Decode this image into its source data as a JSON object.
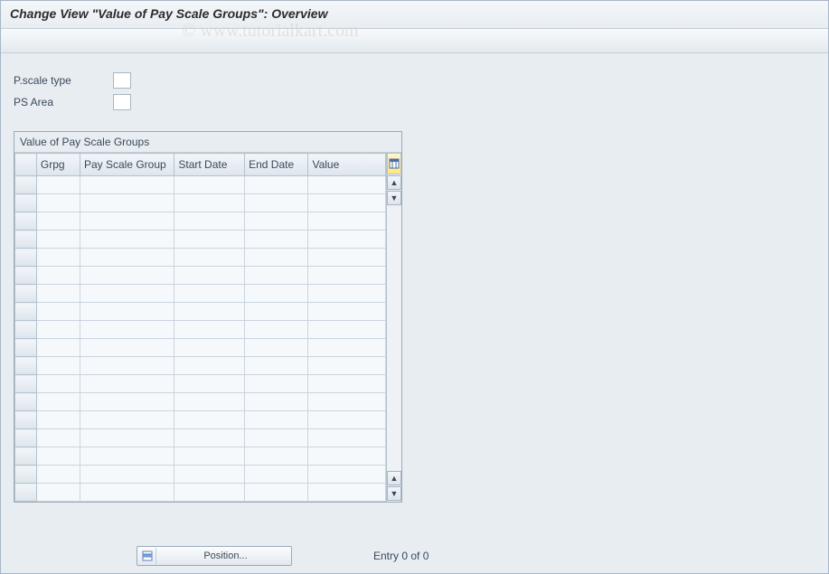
{
  "header": {
    "title": "Change View \"Value of Pay Scale Groups\": Overview"
  },
  "watermark": "© www.tutorialkart.com",
  "form": {
    "pscale_type_label": "P.scale type",
    "pscale_type_value": "",
    "ps_area_label": "PS Area",
    "ps_area_value": ""
  },
  "table": {
    "title": "Value of Pay Scale Groups",
    "columns": {
      "grpg": "Grpg",
      "psg": "Pay Scale Group",
      "start": "Start Date",
      "end": "End Date",
      "value": "Value"
    },
    "blank_row_count": 18
  },
  "footer": {
    "position_label": "Position...",
    "entry_text": "Entry 0 of 0"
  },
  "icons": {
    "config": "config-icon",
    "scroll_up": "▲",
    "scroll_down": "▼"
  }
}
